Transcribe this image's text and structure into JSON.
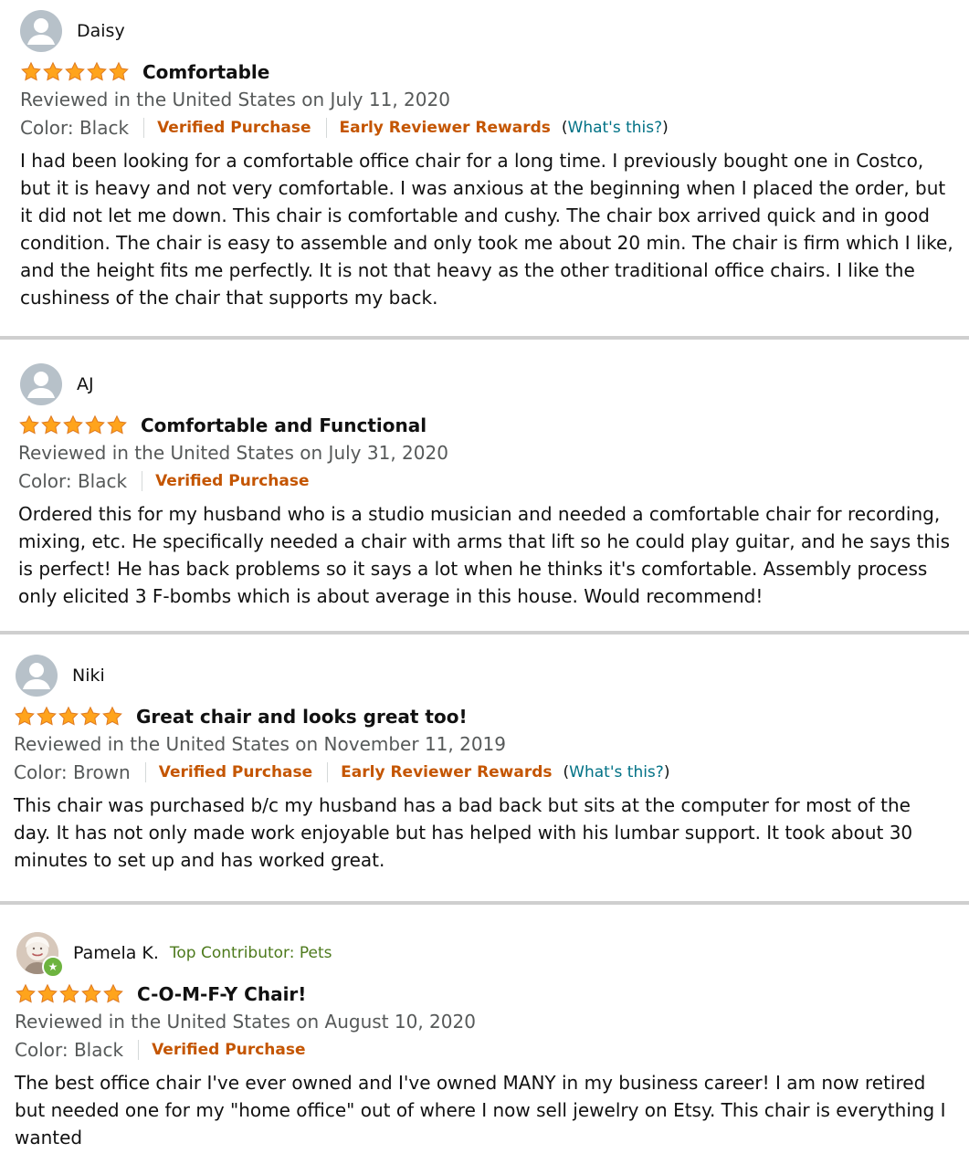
{
  "reviews": [
    {
      "name": "Daisy",
      "rating": 5,
      "title": "Comfortable",
      "date": "Reviewed in the United States on July 11, 2020",
      "color": "Color: Black",
      "verified": "Verified Purchase",
      "reward": "Early Reviewer Rewards",
      "whats_open": "(",
      "whats": "What's this?",
      "whats_close": ")",
      "body": "I had been looking for a comfortable office chair for a long time. I previously bought one in Costco, but it is heavy and not very comfortable. I was anxious at the beginning when I placed the order, but it did not let me down. This chair is comfortable and cushy. The chair box arrived quick and in good condition. The chair is easy to assemble and only took me about 20 min. The chair is firm which I like, and the height fits me perfectly. It is not that heavy as the other traditional office chairs. I like the cushiness of the chair that supports my back."
    },
    {
      "name": "AJ",
      "rating": 5,
      "title": "Comfortable and Functional",
      "date": "Reviewed in the United States on July 31, 2020",
      "color": "Color: Black",
      "verified": "Verified Purchase",
      "body": "Ordered this for my husband who is a studio musician and needed a comfortable chair for recording, mixing, etc. He specifically needed a chair with arms that lift so he could play guitar, and he says this is perfect! He has back problems so it says a lot when he thinks it's comfortable. Assembly process only elicited 3 F-bombs which is about average in this house. Would recommend!"
    },
    {
      "name": "Niki",
      "rating": 5,
      "title": "Great chair and looks great too!",
      "date": "Reviewed in the United States on November 11, 2019",
      "color": "Color: Brown",
      "verified": "Verified Purchase",
      "reward": "Early Reviewer Rewards",
      "whats_open": "(",
      "whats": "What's this?",
      "whats_close": ")",
      "body": "This chair was purchased b/c my husband has a bad back but sits at the computer for most of the day. It has not only made work enjoyable but has helped with his lumbar support. It took about 30 minutes to set up and has worked great."
    },
    {
      "name": "Pamela K.",
      "contributor": "Top Contributor: Pets",
      "rating": 5,
      "title": "C-O-M-F-Y Chair!",
      "date": "Reviewed in the United States on August 10, 2020",
      "color": "Color: Black",
      "verified": "Verified Purchase",
      "body": "The best office chair I've ever owned and I've owned MANY in my business career! I am now retired but needed one for my \"home office\" out of where I now sell jewelry on Etsy. This chair is everything I wanted"
    }
  ],
  "icons": {
    "star": "star-icon",
    "avatar": "default-avatar-icon",
    "badge": "star-badge-icon"
  },
  "colors": {
    "star_fill": "#ffa41c",
    "star_stroke": "#de7921",
    "verified": "#c45500",
    "link": "#007185",
    "muted": "#565959",
    "contributor": "#4d7a1c",
    "divider": "#cfcfcf"
  }
}
